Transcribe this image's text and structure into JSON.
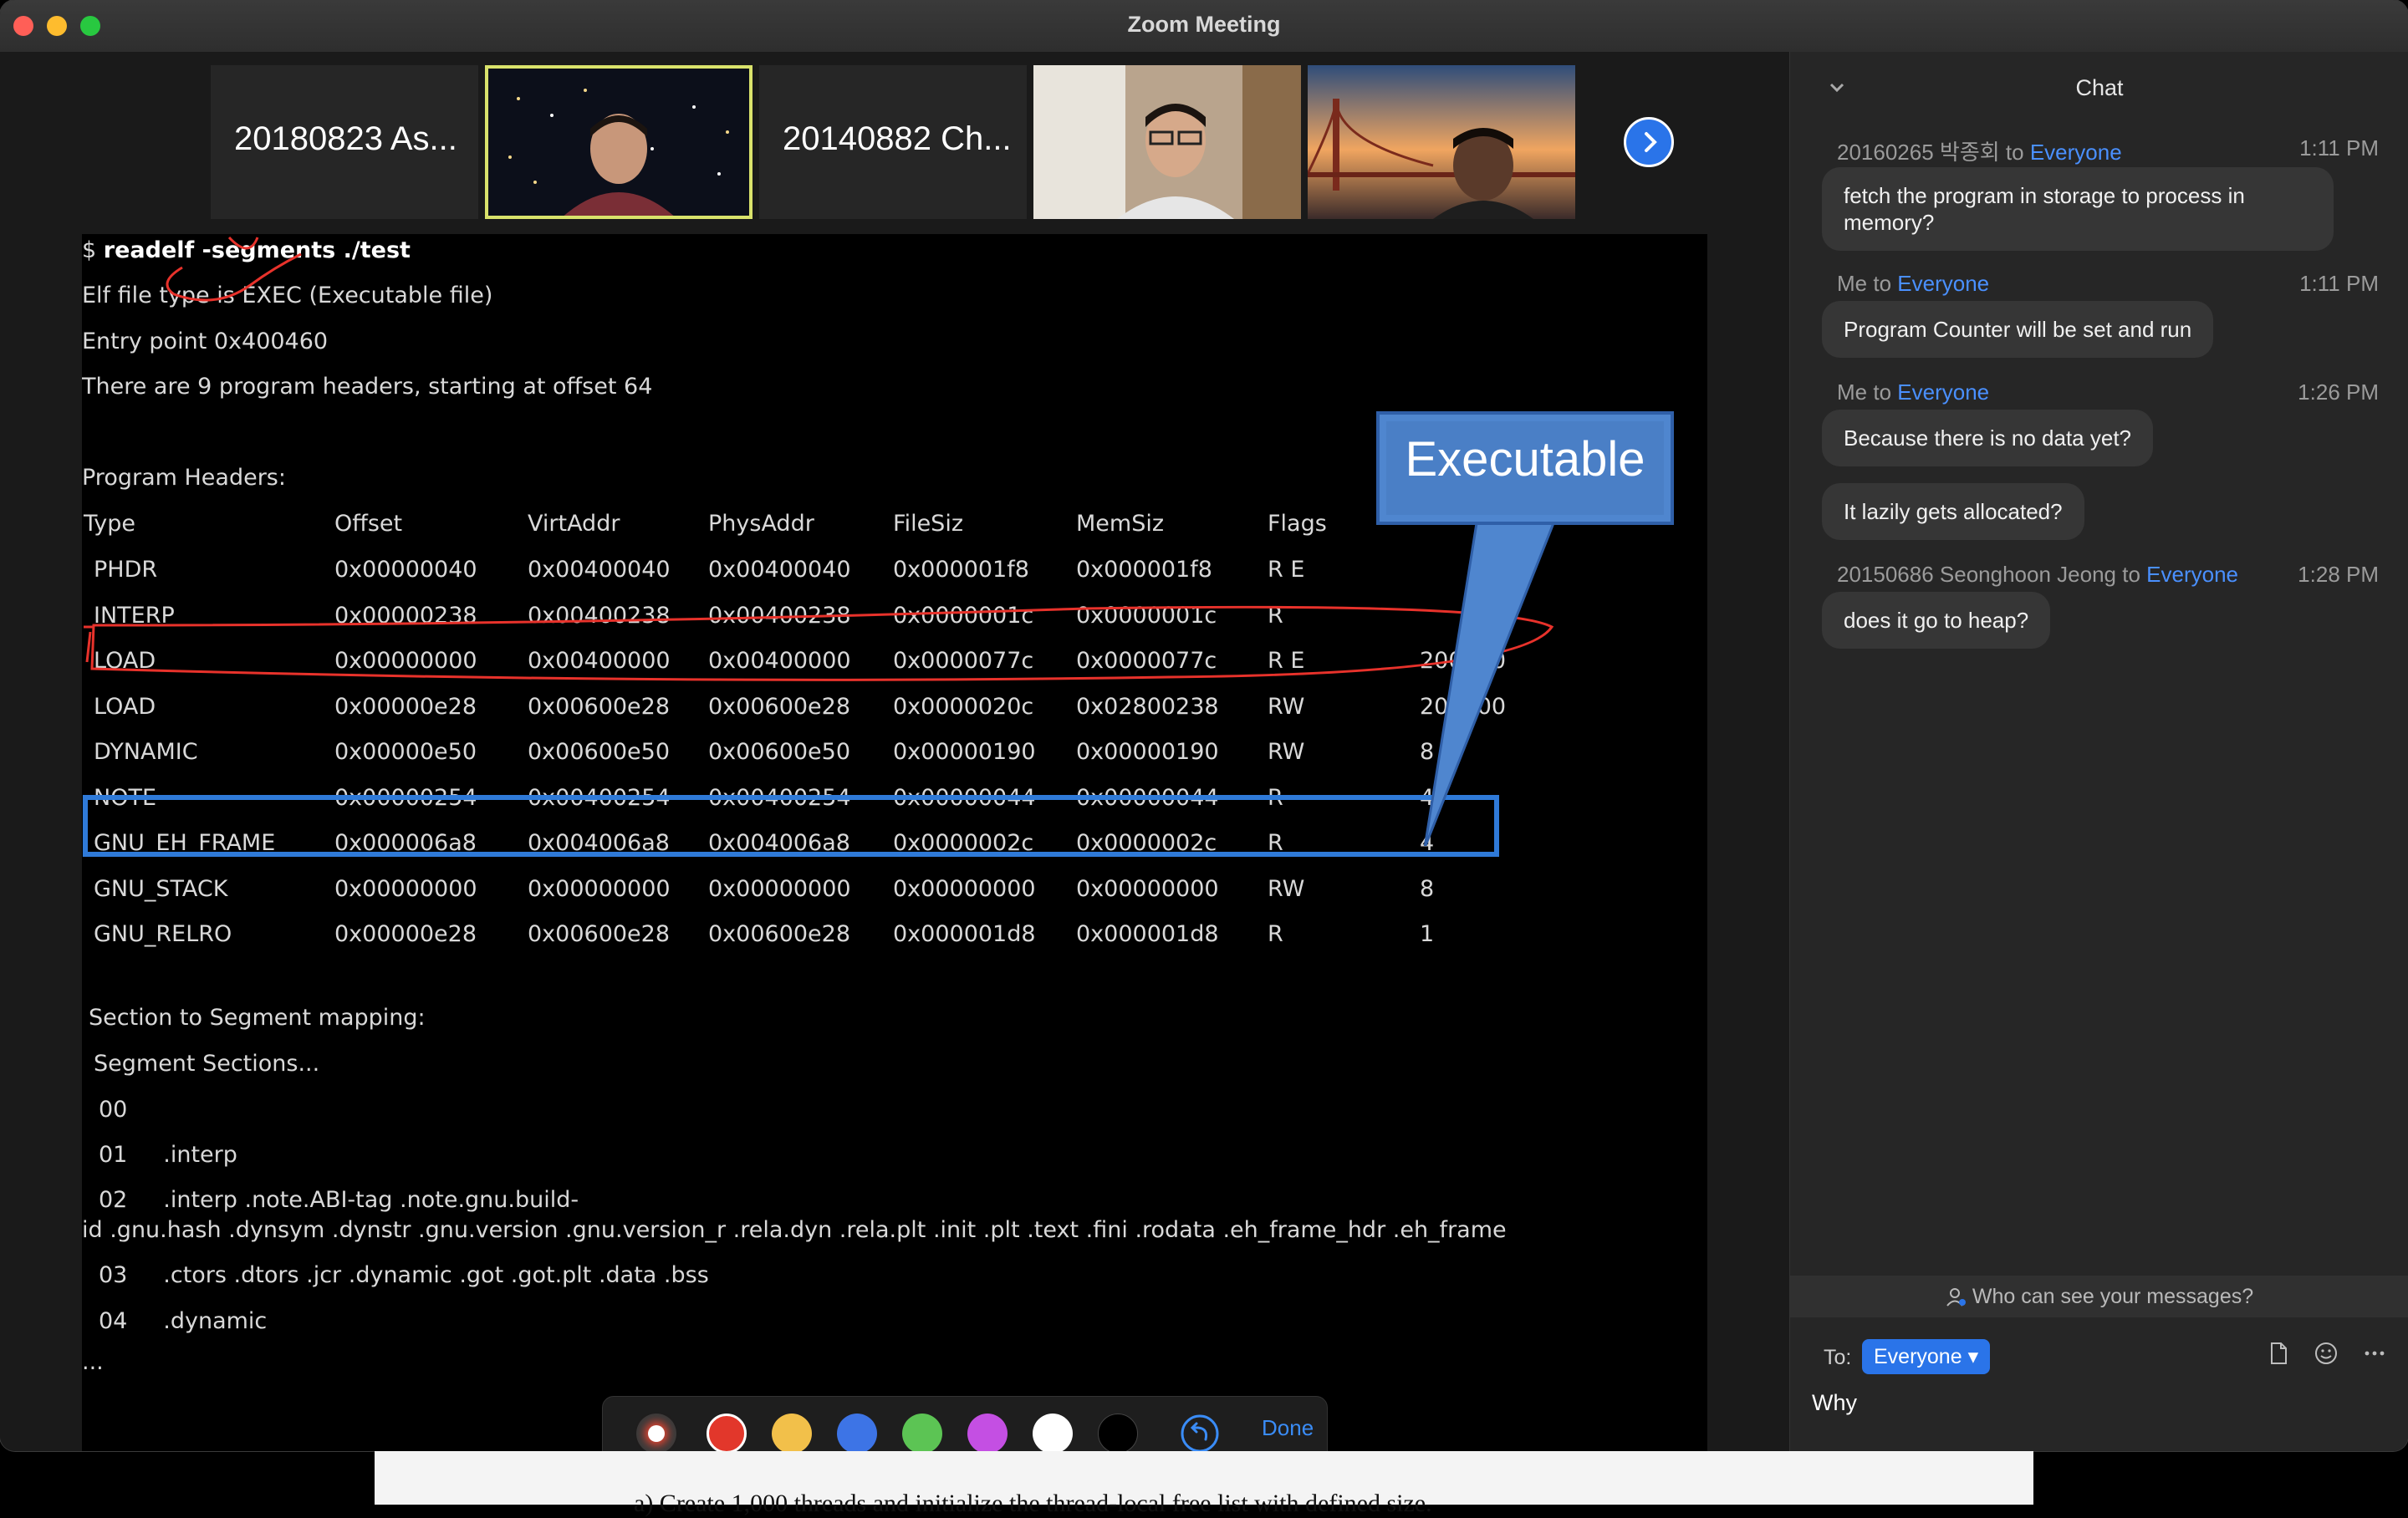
{
  "window": {
    "title": "Zoom Meeting"
  },
  "gallery": {
    "tiles": [
      {
        "name": "20180823 As..."
      },
      {
        "name": ""
      },
      {
        "name": "20140882 Ch..."
      },
      {
        "name": ""
      },
      {
        "name": ""
      }
    ],
    "next_icon": "chevron-right-icon"
  },
  "share": {
    "prompt": "$",
    "command": "readelf -segments ./test",
    "lines": [
      "Elf file type is EXEC (Executable file)",
      "Entry point 0x400460",
      "There are 9 program headers, starting at offset 64",
      "Program Headers:"
    ],
    "headers": [
      "Type",
      "Offset",
      "VirtAddr",
      "PhysAddr",
      "FileSiz",
      "MemSiz",
      "Flags"
    ],
    "rows": [
      [
        "PHDR",
        "0x00000040",
        "0x00400040",
        "0x00400040",
        "0x000001f8",
        "0x000001f8",
        "R E",
        ""
      ],
      [
        "INTERP",
        "0x00000238",
        "0x00400238",
        "0x00400238",
        "0x0000001c",
        "0x0000001c",
        "R",
        ""
      ],
      [
        "LOAD",
        "0x00000000",
        "0x00400000",
        "0x00400000",
        "0x0000077c",
        "0x0000077c",
        "R E",
        "200000"
      ],
      [
        "LOAD",
        "0x00000e28",
        "0x00600e28",
        "0x00600e28",
        "0x0000020c",
        "0x02800238",
        "RW",
        "200000"
      ],
      [
        "DYNAMIC",
        "0x00000e50",
        "0x00600e50",
        "0x00600e50",
        "0x00000190",
        "0x00000190",
        "RW",
        "8"
      ],
      [
        "NOTE",
        "0x00000254",
        "0x00400254",
        "0x00400254",
        "0x00000044",
        "0x00000044",
        "R",
        "4"
      ],
      [
        "GNU_EH_FRAME",
        "0x000006a8",
        "0x004006a8",
        "0x004006a8",
        "0x0000002c",
        "0x0000002c",
        "R",
        "4"
      ],
      [
        "GNU_STACK",
        "0x00000000",
        "0x00000000",
        "0x00000000",
        "0x00000000",
        "0x00000000",
        "RW",
        "8"
      ],
      [
        "GNU_RELRO",
        "0x00000e28",
        "0x00600e28",
        "0x00600e28",
        "0x000001d8",
        "0x000001d8",
        "R",
        "1"
      ]
    ],
    "mapping_title": "Section to Segment mapping:",
    "mapping_header": "Segment Sections...",
    "mapping": [
      "00",
      "01     .interp",
      "02     .interp .note.ABI-tag .note.gnu.build-",
      "id .gnu.hash .dynsym .dynstr .gnu.version .gnu.version_r .rela.dyn .rela.plt .init .plt .text .fini .rodata .eh_frame_hdr .eh_frame",
      "03     .ctors .dtors .jcr .dynamic .got .got.plt .data .bss",
      "04     .dynamic",
      "..."
    ],
    "callout": "Executable",
    "colors": {
      "annot_red": "#e8322b",
      "annot_blue": "#2f7ad8",
      "callout_blue": "#4f86cf"
    }
  },
  "annotation_toolbar": {
    "swatches": [
      "#e8432f",
      "#e2372b",
      "#f2c04a",
      "#3d74e6",
      "#5cc454",
      "#c44fe3",
      "#ffffff",
      "#000000"
    ],
    "undo_icon": "undo-icon",
    "done_label": "Done"
  },
  "chat": {
    "title": "Chat",
    "messages": [
      {
        "sender": "20160265 박종회",
        "to_word": "to",
        "to": "Everyone",
        "time": "1:11 PM",
        "text": "fetch the program in storage to process in memory?"
      },
      {
        "sender": "Me",
        "to_word": "to",
        "to": "Everyone",
        "time": "1:11 PM",
        "text": "Program Counter will be set and run"
      },
      {
        "sender": "Me",
        "to_word": "to",
        "to": "Everyone",
        "time": "1:26 PM",
        "text": "Because there is no data yet?"
      },
      {
        "sender": "",
        "to_word": "",
        "to": "",
        "time": "",
        "text": "It lazily gets allocated?"
      },
      {
        "sender": "20150686 Seonghoon Jeong",
        "to_word": "to",
        "to": "Everyone",
        "time": "1:28 PM",
        "text": "does it go to heap?"
      }
    ],
    "privacy_text": "Who can see your messages?",
    "compose": {
      "to_label": "To:",
      "to_value": "Everyone",
      "draft": "Why"
    }
  },
  "document": {
    "snippet": "a)         Create 1,000 threads and initialize the thread-local free list with defined size."
  }
}
